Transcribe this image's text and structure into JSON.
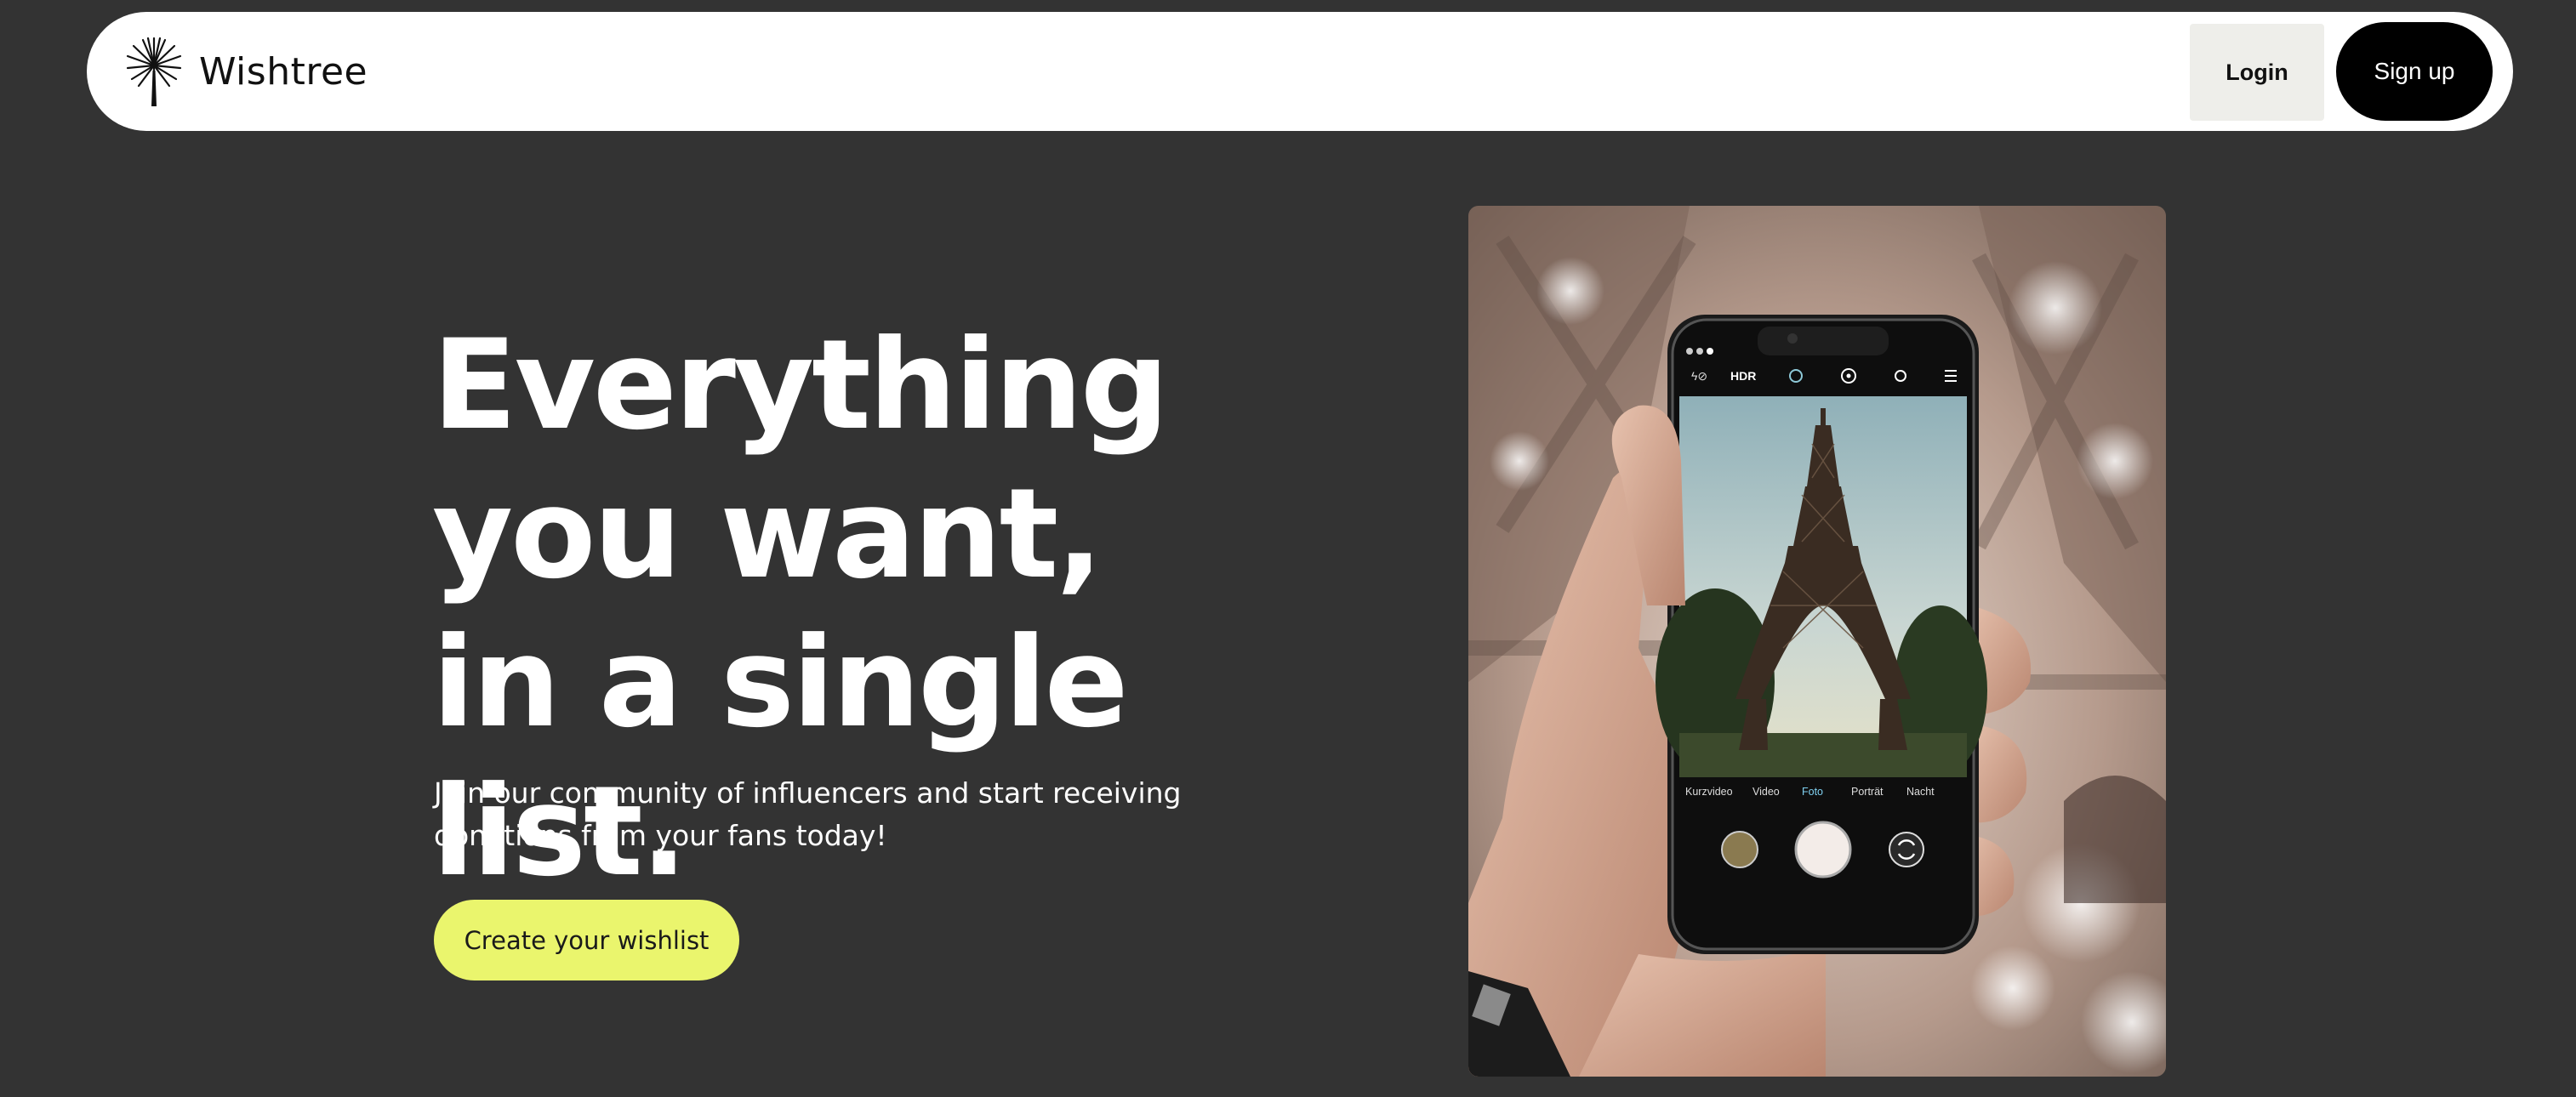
{
  "header": {
    "brand": "Wishtree",
    "login_label": "Login",
    "signup_label": "Sign up"
  },
  "hero": {
    "title": "Everything you want, in a single list.",
    "subtitle": "Join our community of influencers and start receiving donations from your fans today!",
    "cta_label": "Create your wishlist"
  },
  "hero_image": {
    "camera_modes": [
      "Kurzvideo",
      "Video",
      "Foto",
      "Porträt",
      "Nacht"
    ],
    "active_mode": "Foto",
    "camera_top_labels": [
      "HDR"
    ]
  },
  "colors": {
    "page_background": "#333333",
    "header_background": "#ffffff",
    "cta_background": "#eaf56d",
    "signup_background": "#000000",
    "login_background": "#eeeeea"
  },
  "icons": {
    "logo": "dandelion-tree-icon"
  }
}
